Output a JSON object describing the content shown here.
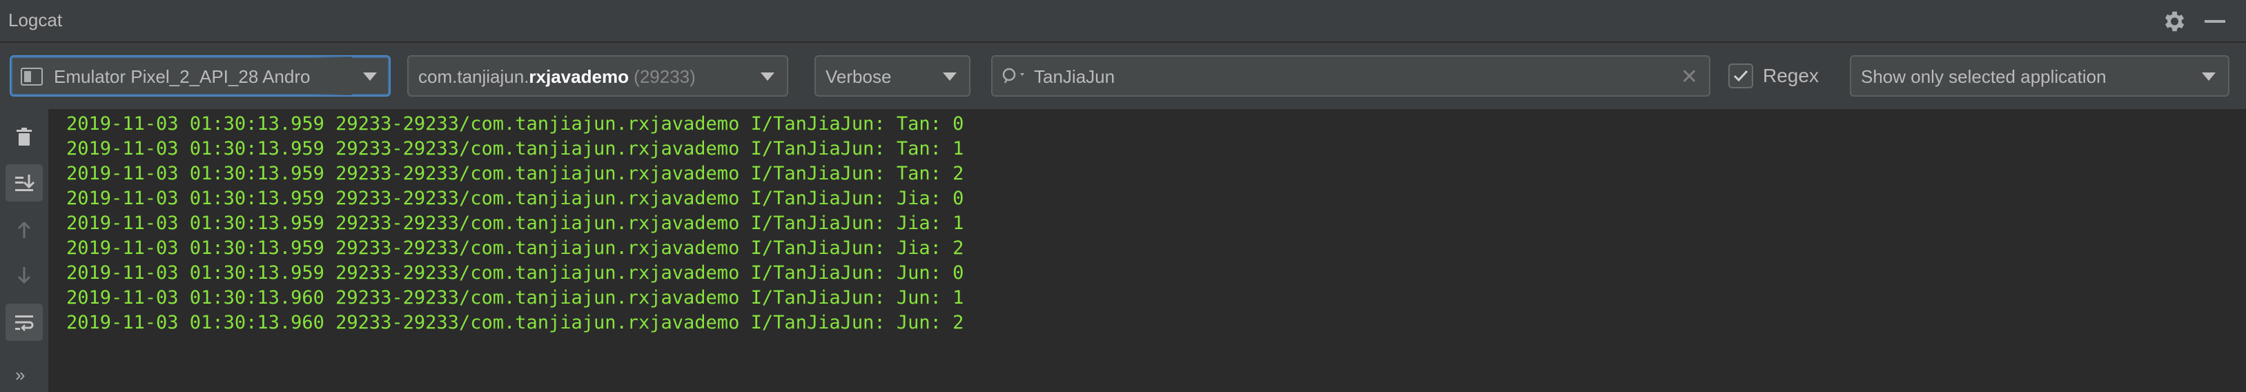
{
  "window": {
    "title": "Logcat"
  },
  "toolbar": {
    "device": "Emulator Pixel_2_API_28 Andro",
    "process_prefix": "com.tanjiajun.",
    "process_bold": "rxjavademo",
    "process_pid": " (29233)",
    "log_level": "Verbose",
    "search_value": "TanJiaJun",
    "regex_label": "Regex",
    "regex_checked": true,
    "filter": "Show only selected application"
  },
  "log_lines": [
    "2019-11-03 01:30:13.959 29233-29233/com.tanjiajun.rxjavademo I/TanJiaJun: Tan: 0",
    "2019-11-03 01:30:13.959 29233-29233/com.tanjiajun.rxjavademo I/TanJiaJun: Tan: 1",
    "2019-11-03 01:30:13.959 29233-29233/com.tanjiajun.rxjavademo I/TanJiaJun: Tan: 2",
    "2019-11-03 01:30:13.959 29233-29233/com.tanjiajun.rxjavademo I/TanJiaJun: Jia: 0",
    "2019-11-03 01:30:13.959 29233-29233/com.tanjiajun.rxjavademo I/TanJiaJun: Jia: 1",
    "2019-11-03 01:30:13.959 29233-29233/com.tanjiajun.rxjavademo I/TanJiaJun: Jia: 2",
    "2019-11-03 01:30:13.959 29233-29233/com.tanjiajun.rxjavademo I/TanJiaJun: Jun: 0",
    "2019-11-03 01:30:13.960 29233-29233/com.tanjiajun.rxjavademo I/TanJiaJun: Jun: 1",
    "2019-11-03 01:30:13.960 29233-29233/com.tanjiajun.rxjavademo I/TanJiaJun: Jun: 2"
  ],
  "sidebar": {
    "icons": [
      "trash-icon",
      "scroll-to-end-icon",
      "up-arrow-icon",
      "down-arrow-icon",
      "soft-wrap-icon"
    ],
    "more": "»"
  },
  "colors": {
    "log_text": "#87e33d",
    "background": "#2b2b2b",
    "panel": "#3c3f41",
    "focus_border": "#4a88c7"
  }
}
